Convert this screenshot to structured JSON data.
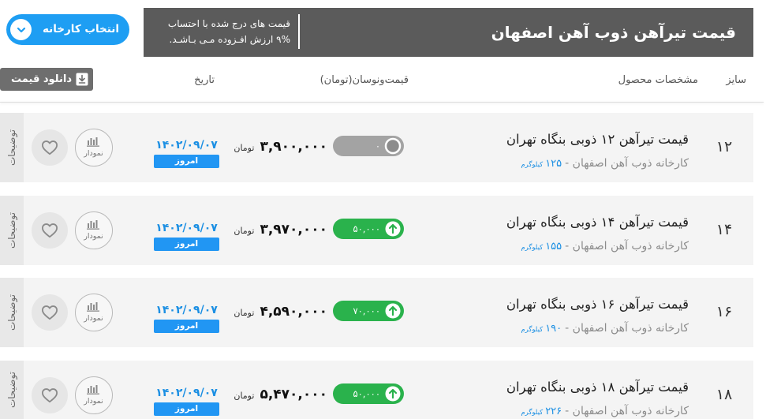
{
  "header": {
    "title": "قیمت تیرآهن ذوب آهن اصفهان",
    "tax_note": [
      "قیمت های درج شده با احتساب",
      "۹% ارزش افـزوده مـی بـاشـد."
    ]
  },
  "factory_selector": {
    "label": "انتخاب کارخانه",
    "icon": "chevron-down-icon"
  },
  "table_header": {
    "size": "سایز",
    "product": "مشخصات محصول",
    "price_change": "قیمت‌ونوسان(تومان)",
    "date": "تاریخ"
  },
  "download_button": {
    "label": "دانلود قیمت",
    "icon": "download-icon"
  },
  "row_icons": {
    "favorite": "heart-icon",
    "chart": "bar-chart-icon",
    "trend_up": "arrow-up-circle-icon",
    "trend_flat": "circle-icon"
  },
  "rows": [
    {
      "side_tab": "توضیحات",
      "size": "۱۲",
      "name": "قیمت تیرآهن ۱۲ ذوبی بنگاه تهران",
      "factory": "کارخانه ذوب آهن اصفهان -",
      "weight": "۱۲۵",
      "weight_unit": "کیلوگرم",
      "price": "۳,۹۰۰,۰۰۰",
      "currency": "تومان",
      "change": "۰",
      "trend": "flat",
      "date": "۱۴۰۲/۰۹/۰۷",
      "date_badge": "امروز",
      "chart_label": "نمودار"
    },
    {
      "side_tab": "توضیحات",
      "size": "۱۴",
      "name": "قیمت تیرآهن ۱۴ ذوبی بنگاه تهران",
      "factory": "کارخانه ذوب آهن اصفهان -",
      "weight": "۱۵۵",
      "weight_unit": "کیلوگرم",
      "price": "۳,۹۷۰,۰۰۰",
      "currency": "تومان",
      "change": "۵۰,۰۰۰",
      "trend": "up",
      "date": "۱۴۰۲/۰۹/۰۷",
      "date_badge": "امروز",
      "chart_label": "نمودار"
    },
    {
      "side_tab": "توضیحات",
      "size": "۱۶",
      "name": "قیمت تیرآهن ۱۶ ذوبی بنگاه تهران",
      "factory": "کارخانه ذوب آهن اصفهان -",
      "weight": "۱۹۰",
      "weight_unit": "کیلوگرم",
      "price": "۴,۵۹۰,۰۰۰",
      "currency": "تومان",
      "change": "۷۰,۰۰۰",
      "trend": "up",
      "date": "۱۴۰۲/۰۹/۰۷",
      "date_badge": "امروز",
      "chart_label": "نمودار"
    },
    {
      "side_tab": "توضیحات",
      "size": "۱۸",
      "name": "قیمت تیرآهن ۱۸ ذوبی بنگاه تهران",
      "factory": "کارخانه ذوب آهن اصفهان -",
      "weight": "۲۲۶",
      "weight_unit": "کیلوگرم",
      "price": "۵,۴۷۰,۰۰۰",
      "currency": "تومان",
      "change": "۵۰,۰۰۰",
      "trend": "up",
      "date": "۱۴۰۲/۰۹/۰۷",
      "date_badge": "امروز",
      "chart_label": "نمودار"
    }
  ],
  "colors": {
    "header_bg": "#5b5b5b",
    "accent_blue": "#1e9ef3",
    "button_gray": "#6e6e6e",
    "row_bg": "#f4f4f4",
    "up_green": "#2ab24c",
    "flat_gray": "#a3a3a3",
    "date_blue": "#1b8fe3",
    "link_blue": "#1b8fe3",
    "badge_blue": "#2196f3"
  }
}
